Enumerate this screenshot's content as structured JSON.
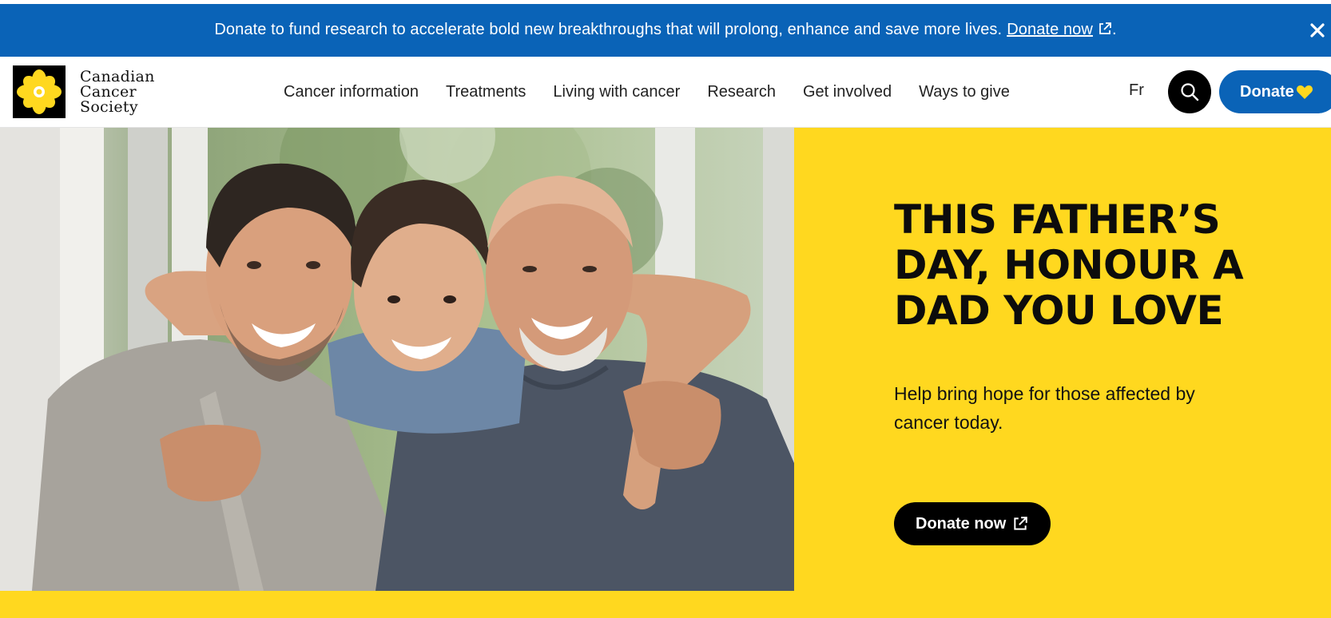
{
  "banner": {
    "message": "Donate to fund research to accelerate bold new breakthroughs that will prolong, enhance and save more lives.",
    "link_label": "Donate now",
    "trailing": ".",
    "external_icon": "external-link-icon",
    "close_icon": "close-icon",
    "background": "#0a63b7"
  },
  "header": {
    "logo": {
      "line1": "Canadian",
      "line2": "Cancer",
      "line3": "Society",
      "icon": "daffodil-logo-icon"
    },
    "nav": [
      {
        "label": "Cancer information"
      },
      {
        "label": "Treatments"
      },
      {
        "label": "Living with cancer"
      },
      {
        "label": "Research"
      },
      {
        "label": "Get involved"
      },
      {
        "label": "Ways to give"
      }
    ],
    "language": "Fr",
    "search_icon": "search-icon",
    "donate_label": "Donate",
    "donate_icon": "heart-icon",
    "donate_color": "#0a63b7",
    "heart_color": "#ffd81f"
  },
  "hero": {
    "title_line1": "THIS FATHER’S",
    "title_line2": "DAY, HONOUR A",
    "title_line3": "DAD YOU LOVE",
    "subtitle": "Help bring hope for those affected by cancer today.",
    "cta_label": "Donate now",
    "cta_icon": "external-link-icon",
    "background": "#ffd81f"
  }
}
